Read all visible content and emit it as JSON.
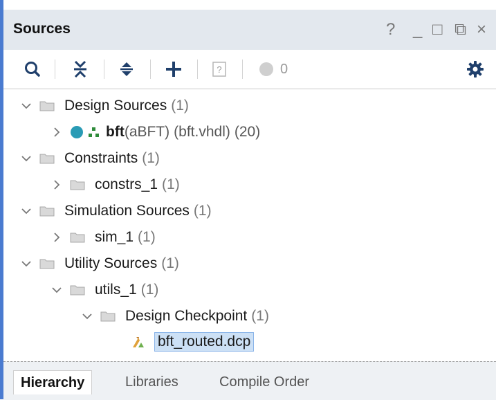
{
  "panel": {
    "title": "Sources",
    "window_controls": [
      "?",
      "_",
      "□",
      "⧉",
      "×"
    ]
  },
  "toolbar": {
    "count": "0",
    "icons": [
      "search-icon",
      "collapse-all-icon",
      "expand-all-icon",
      "add-icon",
      "question-doc-icon",
      "status-circle-icon",
      "gear-icon"
    ]
  },
  "tree": {
    "design_sources": {
      "label": "Design Sources",
      "count": "(1)"
    },
    "bft": {
      "name": "bft",
      "entity": "(aBFT)",
      "file": "(bft.vhdl)",
      "count": "(20)"
    },
    "constraints": {
      "label": "Constraints",
      "count": "(1)"
    },
    "constrs_1": {
      "label": "constrs_1",
      "count": "(1)"
    },
    "simulation_sources": {
      "label": "Simulation Sources",
      "count": "(1)"
    },
    "sim_1": {
      "label": "sim_1",
      "count": "(1)"
    },
    "utility_sources": {
      "label": "Utility Sources",
      "count": "(1)"
    },
    "utils_1": {
      "label": "utils_1",
      "count": "(1)"
    },
    "design_checkpoint": {
      "label": "Design Checkpoint",
      "count": "(1)"
    },
    "dcp": {
      "label": "bft_routed.dcp"
    }
  },
  "tabs": [
    "Hierarchy",
    "Libraries",
    "Compile Order"
  ],
  "colors": {
    "accent": "#4a7bd0",
    "header_bg": "#e3e8ee",
    "selection": "#cce0f5",
    "status_teal": "#2a9bb5"
  }
}
